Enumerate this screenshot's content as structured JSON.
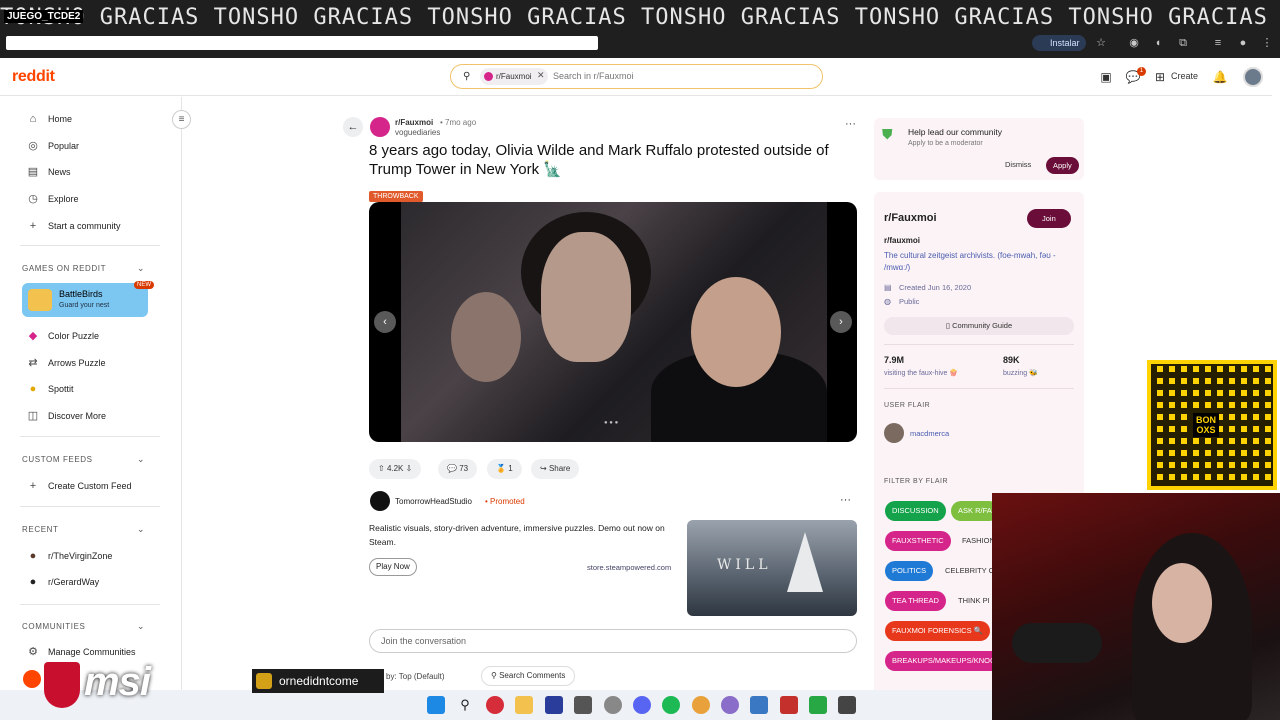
{
  "browser": {
    "ticker_text": "TONSHO GRACIAS TONSHO GRACIAS TONSHO GRACIAS TONSHO GRACIAS TONSHO GRACIAS TONSHO GRACIAS TONSHO GRAC",
    "overlay_tag": "JUEGO_TCDE2",
    "install_label": "Instalar"
  },
  "header": {
    "logo": "reddit",
    "search_chip": "r/Fauxmoi",
    "search_placeholder": "Search in r/Fauxmoi",
    "create_label": "Create",
    "notif_count": "1"
  },
  "sidebar": {
    "nav": [
      {
        "label": "Home",
        "icon": "home-icon"
      },
      {
        "label": "Popular",
        "icon": "popular-icon"
      },
      {
        "label": "News",
        "icon": "news-icon"
      },
      {
        "label": "Explore",
        "icon": "explore-icon"
      },
      {
        "label": "Start a community",
        "icon": "plus-icon"
      }
    ],
    "games_header": "GAMES ON REDDIT",
    "featured_game": {
      "name": "BattleBirds",
      "subtitle": "Guard your nest",
      "badge": "NEW"
    },
    "games": [
      "Color Puzzle",
      "Arrows Puzzle",
      "Spottit",
      "Discover More"
    ],
    "custom_feeds_header": "CUSTOM FEEDS",
    "create_feed": "Create Custom Feed",
    "recent_header": "RECENT",
    "recent": [
      "r/TheVirginZone",
      "r/GerardWay"
    ],
    "communities_header": "COMMUNITIES",
    "manage_communities": "Manage Communities"
  },
  "post": {
    "subreddit": "r/Fauxmoi",
    "time": "• 7mo ago",
    "author": "voguediaries",
    "title": "8 years ago today, Olivia Wilde and Mark Ruffalo protested outside of Trump Tower in New York 🗽",
    "flair": "THROWBACK",
    "votes": "4.2K",
    "comments": "73",
    "awards": "1",
    "share_label": "Share"
  },
  "promoted": {
    "name": "TomorrowHeadStudio",
    "tag": "• Promoted",
    "text": "Realistic visuals, story-driven adventure, immersive puzzles. Demo out now on Steam.",
    "cta": "Play Now",
    "link": "store.steampowered.com",
    "image_title": "WILL"
  },
  "comments_area": {
    "placeholder": "Join the conversation",
    "sort": "by: Top (Default)",
    "search_comments": "Search Comments"
  },
  "right": {
    "mod_title": "Help lead our community",
    "mod_sub": "Apply to be a moderator",
    "dismiss": "Dismiss",
    "apply": "Apply",
    "sub_title": "r/Fauxmoi",
    "join": "Join",
    "sub_handle": "r/fauxmoi",
    "description": "The cultural zeitgeist archivists. (foe-mwah, fəʊ - /mwɑː/)",
    "created": "Created Jun 16, 2020",
    "visibility": "Public",
    "guide": "Community Guide",
    "members": "7.9M",
    "members_label": "visiting the faux-hive 🍿",
    "online": "89K",
    "online_label": "buzzing 🐝",
    "user_flair_header": "USER FLAIR",
    "user_flair_name": "macdmerca",
    "filter_header": "FILTER BY FLAIR",
    "flairs": [
      {
        "label": "DISCUSSION",
        "color": "#14a34a"
      },
      {
        "label": "ASK R/FA",
        "color": "#7fbf3f"
      },
      {
        "label": "FAUXSTHETIC",
        "color": "#d6258a"
      },
      {
        "label": "FASHION",
        "color": "none"
      },
      {
        "label": "POLITICS",
        "color": "#1f7ad6"
      },
      {
        "label": "CELEBRITY CA",
        "color": "none"
      },
      {
        "label": "TEA THREAD",
        "color": "#d6258a"
      },
      {
        "label": "THINK PI",
        "color": "none"
      },
      {
        "label": "FAUXMOI FORENSICS 🔍",
        "color": "#e8381c"
      },
      {
        "label": "BREAKUPS/MAKEUPS/KNOC",
        "color": "#d6258a"
      }
    ]
  },
  "overlays": {
    "qr_label": "BON\nOXS",
    "brand": "msi",
    "twitch_user": "ornedidntcome"
  }
}
